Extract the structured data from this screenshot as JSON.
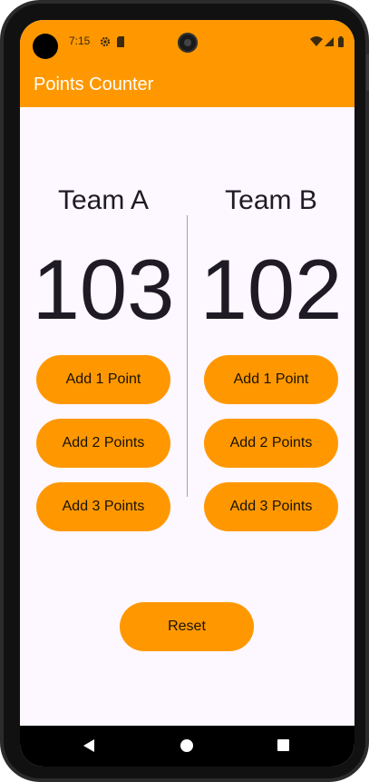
{
  "status_bar": {
    "time": "7:15",
    "icons": [
      "settings-icon",
      "sim-card-icon",
      "wifi-icon",
      "signal-icon",
      "battery-icon"
    ]
  },
  "app": {
    "title": "Points Counter",
    "accent_color": "#ff9800",
    "background_color": "#fdf7ff"
  },
  "team_a": {
    "name": "Team A",
    "score": "103",
    "buttons": [
      "Add 1 Point",
      "Add 2 Points",
      "Add 3 Points"
    ]
  },
  "team_b": {
    "name": "Team B",
    "score": "102",
    "buttons": [
      "Add 1 Point",
      "Add 2 Points",
      "Add 3 Points"
    ]
  },
  "reset_label": "Reset",
  "nav_bar": {
    "icons": [
      "back-icon",
      "home-icon",
      "recents-icon"
    ]
  }
}
